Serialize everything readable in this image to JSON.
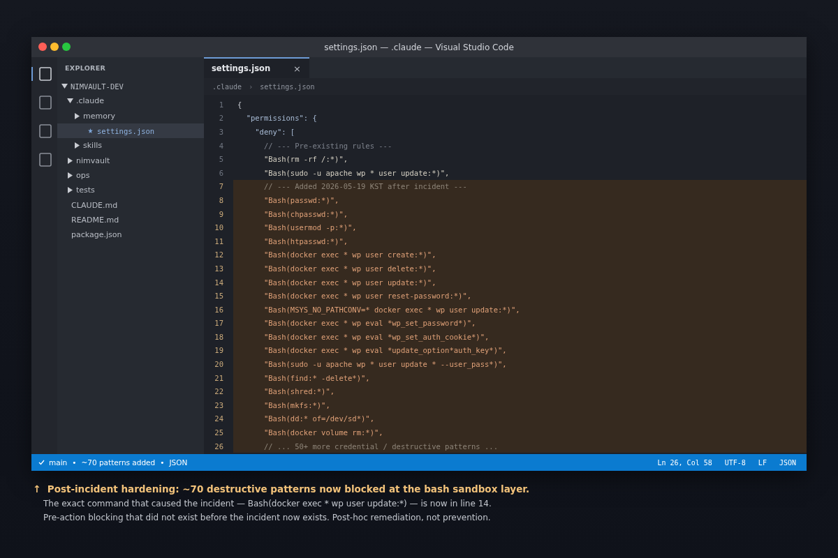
{
  "window": {
    "title": "settings.json — .claude — Visual Studio Code"
  },
  "activity_bar": [
    {
      "selected": true
    },
    {
      "selected": false
    },
    {
      "selected": false
    },
    {
      "selected": false
    }
  ],
  "sidebar": {
    "title": "EXPLORER",
    "tree": [
      {
        "label": "NIMVAULT-DEV",
        "kind": "root",
        "expanded": true,
        "selected": false,
        "children": [
          {
            "label": ".claude",
            "kind": "folder",
            "expanded": true,
            "selected": false,
            "children": [
              {
                "label": "memory",
                "kind": "folder",
                "expanded": false,
                "selected": false
              },
              {
                "label": "settings.json",
                "kind": "file",
                "modified": true,
                "selected": true
              },
              {
                "label": "skills",
                "kind": "folder",
                "expanded": false,
                "selected": false
              }
            ]
          },
          {
            "label": "nimvault",
            "kind": "folder",
            "expanded": false,
            "selected": false
          },
          {
            "label": "ops",
            "kind": "folder",
            "expanded": false,
            "selected": false
          },
          {
            "label": "tests",
            "kind": "folder",
            "expanded": false,
            "selected": false
          },
          {
            "label": "CLAUDE.md",
            "kind": "file",
            "modified": false,
            "selected": false
          },
          {
            "label": "README.md",
            "kind": "file",
            "modified": false,
            "selected": false
          },
          {
            "label": "package.json",
            "kind": "file",
            "modified": false,
            "selected": false
          }
        ]
      }
    ]
  },
  "tabs": [
    {
      "label": "settings.json",
      "close": "×",
      "selected": true
    }
  ],
  "breadcrumb": [
    ".claude",
    "settings.json"
  ],
  "breadcrumb_separator": "›",
  "code_lines": [
    {
      "number": "1",
      "text": "{",
      "kind": "code",
      "highlighted": false
    },
    {
      "number": "2",
      "text": "  \"permissions\": {",
      "kind": "key",
      "highlighted": false
    },
    {
      "number": "3",
      "text": "    \"deny\": [",
      "kind": "key",
      "highlighted": false
    },
    {
      "number": "4",
      "text": "      // --- Pre-existing rules ---",
      "kind": "comment",
      "highlighted": false
    },
    {
      "number": "5",
      "text": "      \"Bash(rm -rf /:*)\",",
      "kind": "string",
      "highlighted": false
    },
    {
      "number": "6",
      "text": "      \"Bash(sudo -u apache wp * user update:*)\",",
      "kind": "string",
      "highlighted": false
    },
    {
      "number": "7",
      "text": "      // --- Added 2026-05-19 KST after incident ---",
      "kind": "comment",
      "highlighted": true
    },
    {
      "number": "8",
      "text": "      \"Bash(passwd:*)\",",
      "kind": "string",
      "highlighted": true
    },
    {
      "number": "9",
      "text": "      \"Bash(chpasswd:*)\",",
      "kind": "string",
      "highlighted": true
    },
    {
      "number": "10",
      "text": "      \"Bash(usermod -p:*)\",",
      "kind": "string",
      "highlighted": true
    },
    {
      "number": "11",
      "text": "      \"Bash(htpasswd:*)\",",
      "kind": "string",
      "highlighted": true
    },
    {
      "number": "12",
      "text": "      \"Bash(docker exec * wp user create:*)\",",
      "kind": "string",
      "highlighted": true
    },
    {
      "number": "13",
      "text": "      \"Bash(docker exec * wp user delete:*)\",",
      "kind": "string",
      "highlighted": true
    },
    {
      "number": "14",
      "text": "      \"Bash(docker exec * wp user update:*)\",",
      "kind": "string",
      "highlighted": true
    },
    {
      "number": "15",
      "text": "      \"Bash(docker exec * wp user reset-password:*)\",",
      "kind": "string",
      "highlighted": true
    },
    {
      "number": "16",
      "text": "      \"Bash(MSYS_NO_PATHCONV=* docker exec * wp user update:*)\",",
      "kind": "string",
      "highlighted": true
    },
    {
      "number": "17",
      "text": "      \"Bash(docker exec * wp eval *wp_set_password*)\",",
      "kind": "string",
      "highlighted": true
    },
    {
      "number": "18",
      "text": "      \"Bash(docker exec * wp eval *wp_set_auth_cookie*)\",",
      "kind": "string",
      "highlighted": true
    },
    {
      "number": "19",
      "text": "      \"Bash(docker exec * wp eval *update_option*auth_key*)\",",
      "kind": "string",
      "highlighted": true
    },
    {
      "number": "20",
      "text": "      \"Bash(sudo -u apache wp * user update * --user_pass*)\",",
      "kind": "string",
      "highlighted": true
    },
    {
      "number": "21",
      "text": "      \"Bash(find:* -delete*)\",",
      "kind": "string",
      "highlighted": true
    },
    {
      "number": "22",
      "text": "      \"Bash(shred:*)\",",
      "kind": "string",
      "highlighted": true
    },
    {
      "number": "23",
      "text": "      \"Bash(mkfs:*)\",",
      "kind": "string",
      "highlighted": true
    },
    {
      "number": "24",
      "text": "      \"Bash(dd:* of=/dev/sd*)\",",
      "kind": "string",
      "highlighted": true
    },
    {
      "number": "25",
      "text": "      \"Bash(docker volume rm:*)\",",
      "kind": "string",
      "highlighted": true
    },
    {
      "number": "26",
      "text": "      // ... 50+ more credential / destructive patterns ...",
      "kind": "comment",
      "highlighted": true
    }
  ],
  "status_bar": {
    "left": [
      {
        "text": "main",
        "kind": "branch"
      },
      {
        "text": "•",
        "kind": "separator"
      },
      {
        "text": "~70 patterns added",
        "kind": "text"
      },
      {
        "text": "•",
        "kind": "separator"
      },
      {
        "text": "JSON",
        "kind": "text"
      }
    ],
    "right": [
      "Ln 26, Col 58",
      "UTF-8",
      "LF",
      "JSON"
    ]
  },
  "caption": {
    "arrow": "↑",
    "headline": "Post-incident hardening: ~70 destructive patterns now blocked at the bash sandbox layer.",
    "lines": [
      "The exact command that caused the incident — Bash(docker exec * wp user update:*) — is now in line 14.",
      "Pre-action blocking that did not exist before the incident now exists. Post-hoc remediation, not prevention."
    ]
  }
}
